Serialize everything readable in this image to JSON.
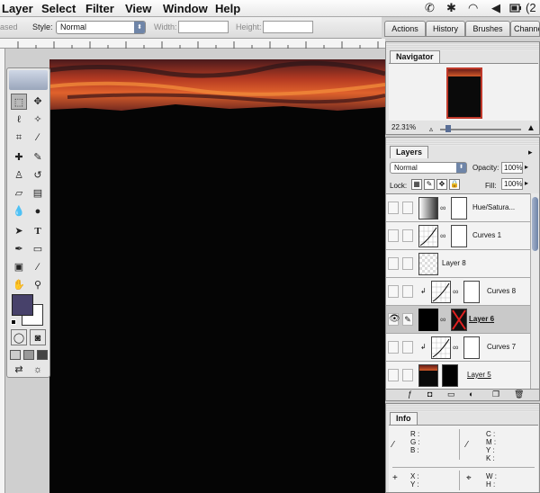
{
  "menubar": {
    "items": [
      "Layer",
      "Select",
      "Filter",
      "View",
      "Window",
      "Help"
    ],
    "tray_text": "(2"
  },
  "options": {
    "based_label": "ased",
    "style_label": "Style:",
    "style_value": "Normal",
    "width_label": "Width:",
    "height_label": "Height:"
  },
  "palette_well": {
    "tabs": [
      "Actions",
      "History",
      "Brushes",
      "Channe"
    ]
  },
  "navigator": {
    "tab": "Navigator",
    "zoom": "22.31%"
  },
  "layers": {
    "tab": "Layers",
    "blend_mode": "Normal",
    "opacity_label": "Opacity:",
    "opacity_value": "100%",
    "lock_label": "Lock:",
    "fill_label": "Fill:",
    "fill_value": "100%",
    "rows": [
      {
        "name": "Hue/Satura...",
        "visible": false
      },
      {
        "name": "Curves 1",
        "visible": false
      },
      {
        "name": "Layer 8",
        "visible": false
      },
      {
        "name": "Curves 8",
        "visible": false
      },
      {
        "name": "Layer 6",
        "visible": true
      },
      {
        "name": "Curves 7",
        "visible": false
      },
      {
        "name": "Layer 5",
        "visible": false
      }
    ]
  },
  "info": {
    "tab": "Info",
    "rgb_labels": [
      "R :",
      "G :",
      "B :"
    ],
    "cmyk_labels": [
      "C :",
      "M :",
      "Y :",
      "K :"
    ],
    "xy_labels": [
      "X :",
      "Y :"
    ],
    "wh_labels": [
      "W :",
      "H :"
    ]
  },
  "icons": {
    "tray": [
      "phone-icon",
      "bluetooth-icon",
      "wifi-icon",
      "volume-icon",
      "battery-icon"
    ]
  },
  "colors": {
    "foreground": "#47416a",
    "sky_orange": "#d6512a",
    "canvas_dark": "#050505"
  }
}
